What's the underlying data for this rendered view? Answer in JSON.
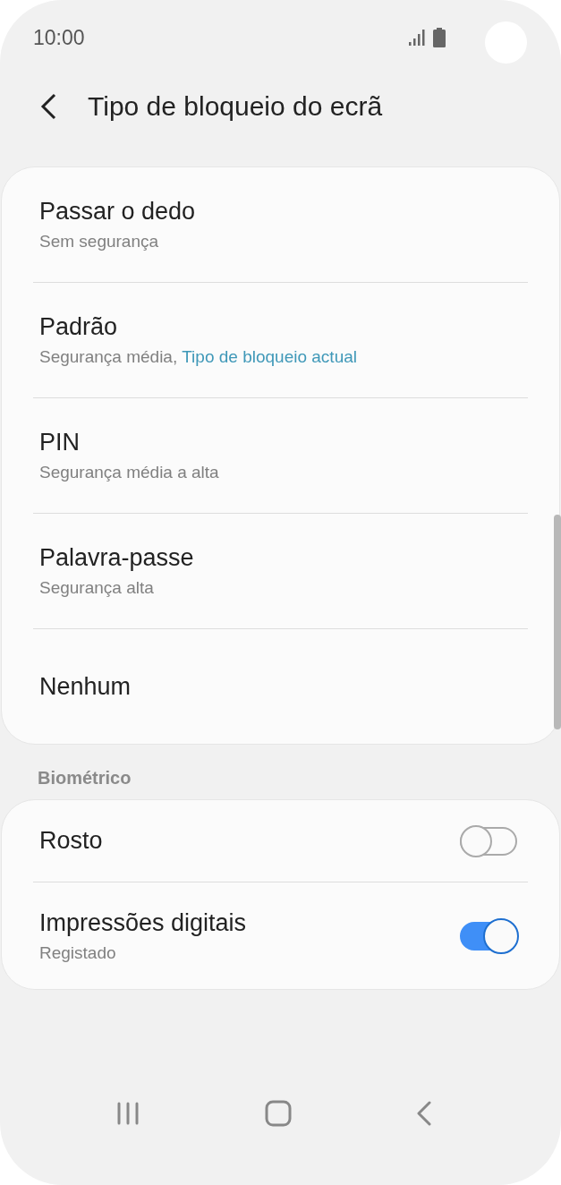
{
  "status_bar": {
    "time": "10:00"
  },
  "header": {
    "title": "Tipo de bloqueio do ecrã"
  },
  "lock_types": [
    {
      "title": "Passar o dedo",
      "subtitle": "Sem segurança"
    },
    {
      "title": "Padrão",
      "subtitle": "Segurança média,",
      "note": "Tipo de bloqueio actual"
    },
    {
      "title": "PIN",
      "subtitle": "Segurança média a alta"
    },
    {
      "title": "Palavra-passe",
      "subtitle": "Segurança alta"
    },
    {
      "title": "Nenhum"
    }
  ],
  "biometric": {
    "heading": "Biométrico",
    "items": [
      {
        "title": "Rosto",
        "on": false
      },
      {
        "title": "Impressões digitais",
        "subtitle": "Registado",
        "on": true
      }
    ]
  }
}
